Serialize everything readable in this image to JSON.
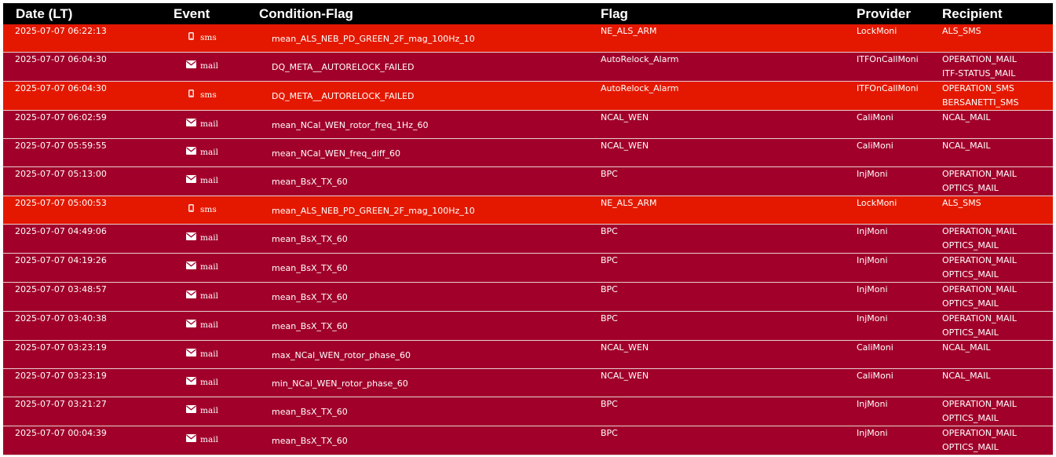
{
  "headers": {
    "date": "Date (LT)",
    "event": "Event",
    "condition": "Condition-Flag",
    "flag": "Flag",
    "provider": "Provider",
    "recipient": "Recipient"
  },
  "colors": {
    "header_bg": "#000000",
    "mail_row": "#a1002a",
    "sms_row": "#e41800",
    "text": "#ffffff"
  },
  "icons": {
    "sms": "phone-icon",
    "mail": "envelope-icon"
  },
  "rows": [
    {
      "date": "2025-07-07 06:22:13",
      "event": "sms",
      "condition": "mean_ALS_NEB_PD_GREEN_2F_mag_100Hz_10",
      "flag": "NE_ALS_ARM",
      "provider": "LockMoni",
      "recipients": [
        "ALS_SMS"
      ]
    },
    {
      "date": "2025-07-07 06:04:30",
      "event": "mail",
      "condition": "DQ_META__AUTORELOCK_FAILED",
      "flag": "AutoRelock_Alarm",
      "provider": "ITFOnCallMoni",
      "recipients": [
        "OPERATION_MAIL",
        "ITF-STATUS_MAIL"
      ]
    },
    {
      "date": "2025-07-07 06:04:30",
      "event": "sms",
      "condition": "DQ_META__AUTORELOCK_FAILED",
      "flag": "AutoRelock_Alarm",
      "provider": "ITFOnCallMoni",
      "recipients": [
        "OPERATION_SMS",
        "BERSANETTI_SMS"
      ]
    },
    {
      "date": "2025-07-07 06:02:59",
      "event": "mail",
      "condition": "mean_NCal_WEN_rotor_freq_1Hz_60",
      "flag": "NCAL_WEN",
      "provider": "CaliMoni",
      "recipients": [
        "NCAL_MAIL"
      ]
    },
    {
      "date": "2025-07-07 05:59:55",
      "event": "mail",
      "condition": "mean_NCal_WEN_freq_diff_60",
      "flag": "NCAL_WEN",
      "provider": "CaliMoni",
      "recipients": [
        "NCAL_MAIL"
      ]
    },
    {
      "date": "2025-07-07 05:13:00",
      "event": "mail",
      "condition": "mean_BsX_TX_60",
      "flag": "BPC",
      "provider": "InjMoni",
      "recipients": [
        "OPERATION_MAIL",
        "OPTICS_MAIL"
      ]
    },
    {
      "date": "2025-07-07 05:00:53",
      "event": "sms",
      "condition": "mean_ALS_NEB_PD_GREEN_2F_mag_100Hz_10",
      "flag": "NE_ALS_ARM",
      "provider": "LockMoni",
      "recipients": [
        "ALS_SMS"
      ]
    },
    {
      "date": "2025-07-07 04:49:06",
      "event": "mail",
      "condition": "mean_BsX_TX_60",
      "flag": "BPC",
      "provider": "InjMoni",
      "recipients": [
        "OPERATION_MAIL",
        "OPTICS_MAIL"
      ]
    },
    {
      "date": "2025-07-07 04:19:26",
      "event": "mail",
      "condition": "mean_BsX_TX_60",
      "flag": "BPC",
      "provider": "InjMoni",
      "recipients": [
        "OPERATION_MAIL",
        "OPTICS_MAIL"
      ]
    },
    {
      "date": "2025-07-07 03:48:57",
      "event": "mail",
      "condition": "mean_BsX_TX_60",
      "flag": "BPC",
      "provider": "InjMoni",
      "recipients": [
        "OPERATION_MAIL",
        "OPTICS_MAIL"
      ]
    },
    {
      "date": "2025-07-07 03:40:38",
      "event": "mail",
      "condition": "mean_BsX_TX_60",
      "flag": "BPC",
      "provider": "InjMoni",
      "recipients": [
        "OPERATION_MAIL",
        "OPTICS_MAIL"
      ]
    },
    {
      "date": "2025-07-07 03:23:19",
      "event": "mail",
      "condition": "max_NCal_WEN_rotor_phase_60",
      "flag": "NCAL_WEN",
      "provider": "CaliMoni",
      "recipients": [
        "NCAL_MAIL"
      ]
    },
    {
      "date": "2025-07-07 03:23:19",
      "event": "mail",
      "condition": "min_NCal_WEN_rotor_phase_60",
      "flag": "NCAL_WEN",
      "provider": "CaliMoni",
      "recipients": [
        "NCAL_MAIL"
      ]
    },
    {
      "date": "2025-07-07 03:21:27",
      "event": "mail",
      "condition": "mean_BsX_TX_60",
      "flag": "BPC",
      "provider": "InjMoni",
      "recipients": [
        "OPERATION_MAIL",
        "OPTICS_MAIL"
      ]
    },
    {
      "date": "2025-07-07 00:04:39",
      "event": "mail",
      "condition": "mean_BsX_TX_60",
      "flag": "BPC",
      "provider": "InjMoni",
      "recipients": [
        "OPERATION_MAIL",
        "OPTICS_MAIL"
      ]
    }
  ]
}
